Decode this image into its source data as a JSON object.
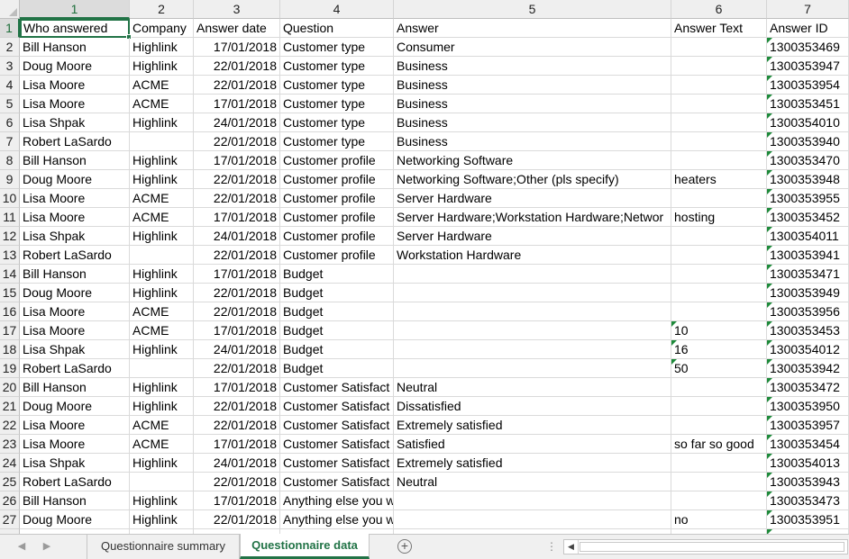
{
  "column_numbers": [
    "1",
    "2",
    "3",
    "4",
    "5",
    "6",
    "7"
  ],
  "headers": [
    "Who answered",
    "Company",
    "Answer date",
    "Question",
    "Answer",
    "Answer Text",
    "Answer ID"
  ],
  "rows": [
    [
      "Bill Hanson",
      "Highlink",
      "17/01/2018",
      "Customer type",
      "Consumer",
      "",
      "1300353469"
    ],
    [
      "Doug Moore",
      "Highlink",
      "22/01/2018",
      "Customer type",
      "Business",
      "",
      "1300353947"
    ],
    [
      "Lisa Moore",
      "ACME",
      "22/01/2018",
      "Customer type",
      "Business",
      "",
      "1300353954"
    ],
    [
      "Lisa Moore",
      "ACME",
      "17/01/2018",
      "Customer type",
      "Business",
      "",
      "1300353451"
    ],
    [
      "Lisa Shpak",
      "Highlink",
      "24/01/2018",
      "Customer type",
      "Business",
      "",
      "1300354010"
    ],
    [
      "Robert LaSardo",
      "",
      "22/01/2018",
      "Customer type",
      "Business",
      "",
      "1300353940"
    ],
    [
      "Bill Hanson",
      "Highlink",
      "17/01/2018",
      "Customer profile",
      "Networking Software",
      "",
      "1300353470"
    ],
    [
      "Doug Moore",
      "Highlink",
      "22/01/2018",
      "Customer profile",
      "Networking Software;Other (pls specify)",
      "heaters",
      "1300353948"
    ],
    [
      "Lisa Moore",
      "ACME",
      "22/01/2018",
      "Customer profile",
      "Server Hardware",
      "",
      "1300353955"
    ],
    [
      "Lisa Moore",
      "ACME",
      "17/01/2018",
      "Customer profile",
      "Server Hardware;Workstation Hardware;Networ",
      "hosting",
      "1300353452"
    ],
    [
      "Lisa Shpak",
      "Highlink",
      "24/01/2018",
      "Customer profile",
      "Server Hardware",
      "",
      "1300354011"
    ],
    [
      "Robert LaSardo",
      "",
      "22/01/2018",
      "Customer profile",
      "Workstation Hardware",
      "",
      "1300353941"
    ],
    [
      "Bill Hanson",
      "Highlink",
      "17/01/2018",
      "Budget",
      "",
      "",
      "1300353471"
    ],
    [
      "Doug Moore",
      "Highlink",
      "22/01/2018",
      "Budget",
      "",
      "",
      "1300353949"
    ],
    [
      "Lisa Moore",
      "ACME",
      "22/01/2018",
      "Budget",
      "",
      "",
      "1300353956"
    ],
    [
      "Lisa Moore",
      "ACME",
      "17/01/2018",
      "Budget",
      "",
      "10",
      "1300353453"
    ],
    [
      "Lisa Shpak",
      "Highlink",
      "24/01/2018",
      "Budget",
      "",
      "16",
      "1300354012"
    ],
    [
      "Robert LaSardo",
      "",
      "22/01/2018",
      "Budget",
      "",
      "50",
      "1300353942"
    ],
    [
      "Bill Hanson",
      "Highlink",
      "17/01/2018",
      "Customer Satisfact",
      "Neutral",
      "",
      "1300353472"
    ],
    [
      "Doug Moore",
      "Highlink",
      "22/01/2018",
      "Customer Satisfact",
      "Dissatisfied",
      "",
      "1300353950"
    ],
    [
      "Lisa Moore",
      "ACME",
      "22/01/2018",
      "Customer Satisfact",
      "Extremely satisfied",
      "",
      "1300353957"
    ],
    [
      "Lisa Moore",
      "ACME",
      "17/01/2018",
      "Customer Satisfact",
      "Satisfied",
      "so far so good",
      "1300353454"
    ],
    [
      "Lisa Shpak",
      "Highlink",
      "24/01/2018",
      "Customer Satisfact",
      "Extremely satisfied",
      "",
      "1300354013"
    ],
    [
      "Robert LaSardo",
      "",
      "22/01/2018",
      "Customer Satisfact",
      "Neutral",
      "",
      "1300353943"
    ],
    [
      "Bill Hanson",
      "Highlink",
      "17/01/2018",
      "Anything else you want to add ?",
      "",
      "",
      "1300353473"
    ],
    [
      "Doug Moore",
      "Highlink",
      "22/01/2018",
      "Anything else you want to add ?",
      "",
      "no",
      "1300353951"
    ]
  ],
  "tabs": {
    "prev_icon": "chevron-left-icon",
    "next_icon": "chevron-right-icon",
    "sheets": [
      "Questionnaire summary",
      "Questionnaire data"
    ],
    "active_sheet": "Questionnaire data",
    "add_icon": "plus-circle-icon"
  },
  "colors": {
    "accent": "#217346",
    "number_as_text_marker": "#1d8a3a"
  }
}
